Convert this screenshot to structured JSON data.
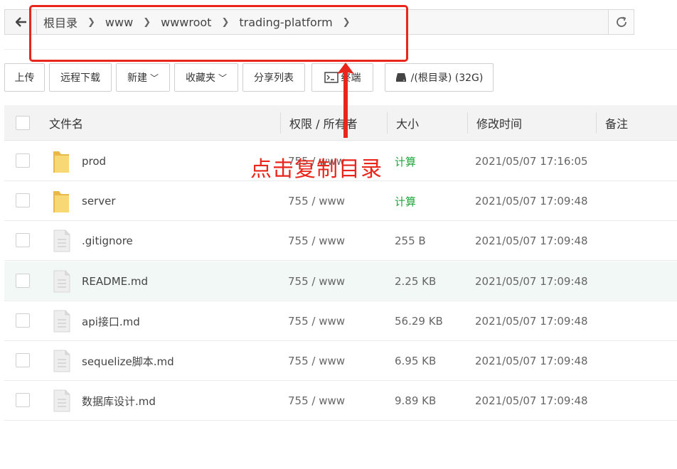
{
  "breadcrumb": [
    "根目录",
    "www",
    "wwwroot",
    "trading-platform"
  ],
  "toolbar": {
    "upload": "上传",
    "remote_download": "远程下载",
    "new": "新建",
    "favorites": "收藏夹",
    "share_list": "分享列表",
    "terminal": "终端",
    "disk": "/(根目录) (32G)"
  },
  "table": {
    "headers": {
      "name": "文件名",
      "perm": "权限 / 所有者",
      "size": "大小",
      "mtime": "修改时间",
      "note": "备注"
    },
    "rows": [
      {
        "type": "folder",
        "name": "prod",
        "perm": "755 / www",
        "size": "计算",
        "mtime": "2021/05/07 17:16:05"
      },
      {
        "type": "folder",
        "name": "server",
        "perm": "755 / www",
        "size": "计算",
        "mtime": "2021/05/07 17:09:48"
      },
      {
        "type": "file",
        "name": ".gitignore",
        "perm": "755 / www",
        "size": "255 B",
        "mtime": "2021/05/07 17:09:48"
      },
      {
        "type": "file",
        "name": "README.md",
        "perm": "755 / www",
        "size": "2.25 KB",
        "mtime": "2021/05/07 17:09:48"
      },
      {
        "type": "file",
        "name": "api接口.md",
        "perm": "755 / www",
        "size": "56.29 KB",
        "mtime": "2021/05/07 17:09:48"
      },
      {
        "type": "file",
        "name": "sequelize脚本.md",
        "perm": "755 / www",
        "size": "6.95 KB",
        "mtime": "2021/05/07 17:09:48"
      },
      {
        "type": "file",
        "name": "数据库设计.md",
        "perm": "755 / www",
        "size": "9.89 KB",
        "mtime": "2021/05/07 17:09:48"
      }
    ]
  },
  "annotation": {
    "text": "点击复制目录",
    "color": "#e8261c"
  },
  "colors": {
    "accent_green": "#20a53a",
    "folder_yellow": "#f8d06a",
    "row_highlight": "#f1f8f5"
  }
}
